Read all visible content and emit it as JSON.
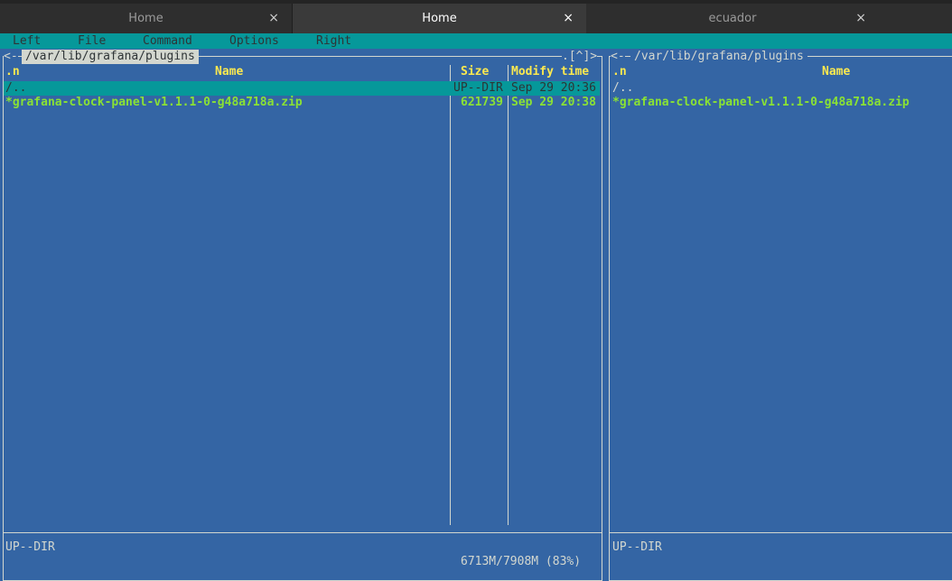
{
  "tabs": [
    {
      "label": "Home"
    },
    {
      "label": "Home"
    },
    {
      "label": "ecuador"
    }
  ],
  "close_glyph": "×",
  "menu": [
    "Left",
    "File",
    "Command",
    "Options",
    "Right"
  ],
  "left_panel": {
    "path": "/var/lib/grafana/plugins",
    "arrow_left": "<-",
    "arrow_right": ".[^]>",
    "columns": {
      "n": ".n",
      "name": "Name",
      "size": "Size",
      "mtime": "Modify time"
    },
    "rows": [
      {
        "name": "/..",
        "size": "UP--DIR",
        "mtime": "Sep 29 20:36"
      },
      {
        "name": "*grafana-clock-panel-v1.1.1-0-g48a718a.zip",
        "size": "621739",
        "mtime": "Sep 29 20:38"
      }
    ],
    "status": "UP--DIR",
    "disk": "6713M/7908M (83%)"
  },
  "right_panel": {
    "path": "/var/lib/grafana/plugins",
    "arrow_left": "<-",
    "columns": {
      "n": ".n",
      "name": "Name"
    },
    "rows": [
      {
        "name": "/.."
      },
      {
        "name": "*grafana-clock-panel-v1.1.1-0-g48a718a.zip"
      }
    ],
    "status": "UP--DIR"
  },
  "colors": {
    "panel_bg": "#3465a4",
    "selection": "#06989a",
    "header_text": "#fce94f",
    "executable_text": "#8ae234"
  }
}
